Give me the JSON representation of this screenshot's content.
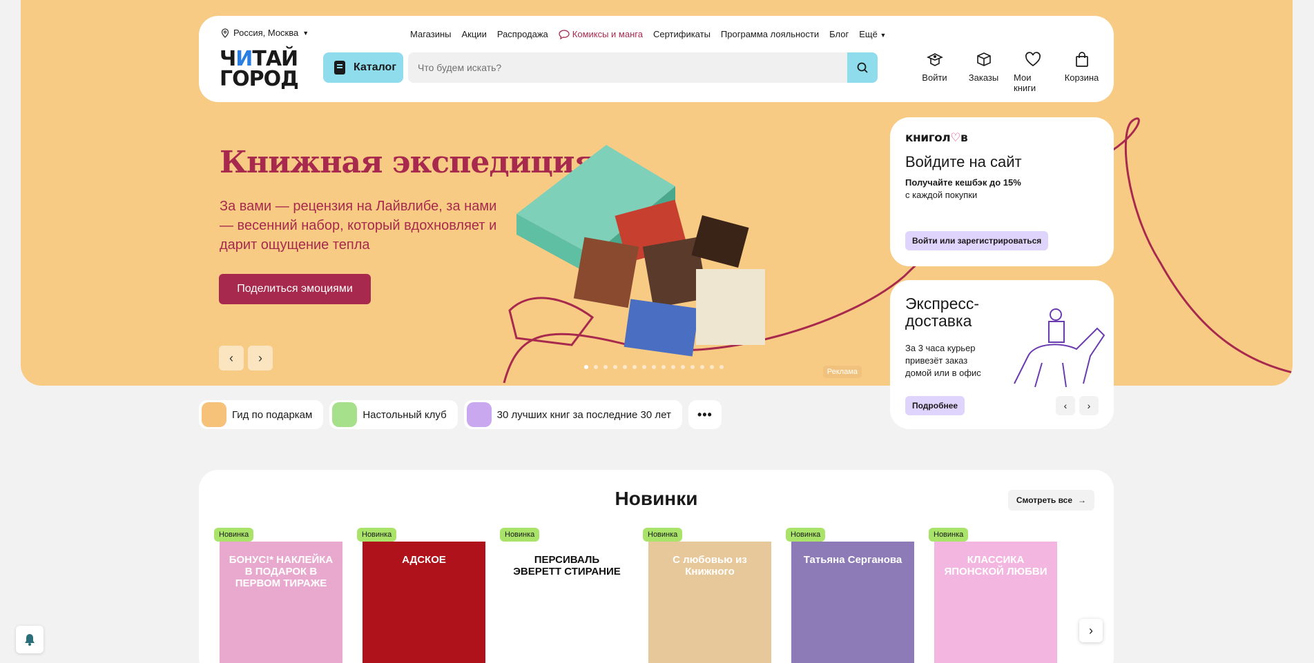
{
  "header": {
    "location": "Россия, Москва",
    "nav": [
      "Магазины",
      "Акции",
      "Распродажа",
      "Комиксы и манга",
      "Сертификаты",
      "Программа лояльности",
      "Блог",
      "Ещё"
    ],
    "logo_line1_a": "Ч",
    "logo_line1_b": "И",
    "logo_line1_c": "ТАЙ",
    "logo_line2": "ГОРОД",
    "catalog_label": "Каталог",
    "search_placeholder": "Что будем искать?",
    "actions": {
      "login": "Войти",
      "orders": "Заказы",
      "my_books": "Мои книги",
      "cart": "Корзина"
    }
  },
  "banner": {
    "title": "Книжная экспедиция",
    "text": "За вами — рецензия на Лайвлибе, за нами — весенний набор, который вдохновляет и дарит ощущение тепла",
    "button": "Поделиться эмоциями",
    "ad_label": "Реклама",
    "slides": 15,
    "active_slide": 1
  },
  "card_login": {
    "brand": "книгол",
    "brand_heart": "♡",
    "brand_end": "в",
    "title": "Войдите на сайт",
    "subtitle": "Получайте кешбэк до 15%",
    "subtitle2": "с каждой покупки",
    "button": "Войти или зарегистрироваться"
  },
  "card_delivery": {
    "title": "Экспресс-доставка",
    "text": "За 3 часа курьер привезёт заказ домой или в офис",
    "button": "Подробнее"
  },
  "chips": [
    {
      "label": "Гид по подаркам",
      "color": "#f6c27a"
    },
    {
      "label": "Настольный клуб",
      "color": "#a7e08b"
    },
    {
      "label": "30 лучших книг за последние 30 лет",
      "color": "#c9a8ef"
    }
  ],
  "new_section": {
    "title": "Новинки",
    "see_all": "Смотреть все",
    "badge": "Новинка",
    "books": [
      {
        "cover_text": "БОНУС!* НАКЛЕЙКА В ПОДАРОК В ПЕРВОМ ТИРАЖЕ",
        "color": "#e9a9cf"
      },
      {
        "cover_text": "АДСКОЕ",
        "color": "#b0121b"
      },
      {
        "cover_text": "ПЕРСИВАЛЬ ЭВЕРЕТТ СТИРАНИЕ",
        "color": "#ffffff"
      },
      {
        "cover_text": "С любовью из Книжного",
        "color": "#e7c89a"
      },
      {
        "cover_text": "Татьяна Серганова",
        "color": "#8d7bb7"
      },
      {
        "cover_text": "КЛАССИКА ЯПОНСКОЙ ЛЮБВИ",
        "color": "#f2b6e0"
      }
    ]
  },
  "colors": {
    "accent": "#a7294d",
    "hero_bg": "#f8cb85",
    "catalog": "#8fdced",
    "badge": "#a9e36a"
  }
}
